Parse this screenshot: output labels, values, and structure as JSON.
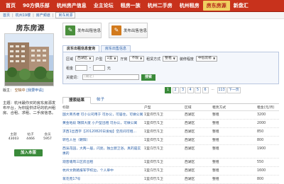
{
  "nav": {
    "items": [
      "首页",
      "90方俱乐部",
      "杭州房产信息",
      "业主论坛",
      "租房一族",
      "杭州二手房",
      "杭州租房",
      "房东房源",
      "新盘汇"
    ],
    "active_index": 7
  },
  "breadcrumb": {
    "items": [
      "首页",
      "杭州19楼",
      "房产频道"
    ],
    "current": "房东房源"
  },
  "sidebar": {
    "title": "房东房源",
    "owner_label": "版主：",
    "owner_vacant": "空缺中",
    "apply_link": "[我要申请]",
    "intro_label": "主题：",
    "intro_text": "杭州最你买的房东房源发布平台，为你提供详尽的杭州租房、合租、求租、二手房信息。",
    "stats": [
      {
        "label": "主题",
        "value": "43003"
      },
      {
        "label": "帖子",
        "value": "4466"
      },
      {
        "label": "会员",
        "value": "5957"
      }
    ],
    "follow_button": "加入本版"
  },
  "actions": {
    "rent_button": "发布出租信息",
    "sell_button": "发布出售信息"
  },
  "search": {
    "tabs": [
      "房东出租信息查询",
      "房东出售信息"
    ],
    "region_label": "区域",
    "region_value": "西湖区",
    "room_label": "户型",
    "room_value": "1室",
    "rooms_label": "厅房",
    "rooms_value": "不限",
    "rent_type_label": "租赁方式",
    "rent_type_value": "整租",
    "decor_label": "装修程度",
    "decor_value": "中低装修",
    "price_label": "租金",
    "price_unit": "元",
    "keyword_label": "关键词：",
    "keyword_placeholder": "[确定]",
    "button": "搜索"
  },
  "pager": {
    "pages": [
      "1",
      "2",
      "3",
      "4",
      "5",
      "6",
      "...",
      "113",
      "下一页"
    ],
    "active": "1"
  },
  "result_tabs": [
    "搜索结果",
    "帖子"
  ],
  "table": {
    "headers": [
      "标题",
      "户型",
      "区域",
      "租赁方式",
      "租金(元/月)"
    ],
    "rows": [
      {
        "title": "国大商务楼 可小公司用于 可办公，可居住，可做公寓",
        "type": "1室/0厅/1卫",
        "area": "西湖区",
        "rent": "整租",
        "price": "3200"
      },
      {
        "title": "黄金地段 瑞祺大厦 小户型出租 可办公，可做公寓",
        "type": "1室/0厅/1卫",
        "area": "西湖区",
        "rent": "整租",
        "price": "2000"
      },
      {
        "title": "求西1出西字【20120820日发帖】空房间可租...",
        "type": "1室/0厅/1卫",
        "area": "西湖区",
        "rent": "整租",
        "price": "850"
      },
      {
        "title": "转包人住（朝阳）",
        "type": "1室/0厅/1卫",
        "area": "西湖区",
        "rent": "整租",
        "price": "800"
      },
      {
        "title": "西溪花园，大两一居，闪亮，独立厨卫浴，真的是实惠的",
        "type": "1室/1厅/1卫",
        "area": "西湖区",
        "rent": "整租",
        "price": "1900"
      },
      {
        "title": "观音塘周三区房出租",
        "type": "1室/0厅/1卫",
        "area": "西湖区",
        "rent": "整租",
        "price": "550"
      },
      {
        "title": "杭州文教路报军学校边，个人单中",
        "type": "1室/1厅/1卫",
        "area": "西湖区",
        "rent": "整租",
        "price": "1600"
      },
      {
        "title": "蒋花苑17号",
        "type": "1室/0厅/1卫",
        "area": "西湖区",
        "rent": "整租",
        "price": "800"
      }
    ]
  }
}
